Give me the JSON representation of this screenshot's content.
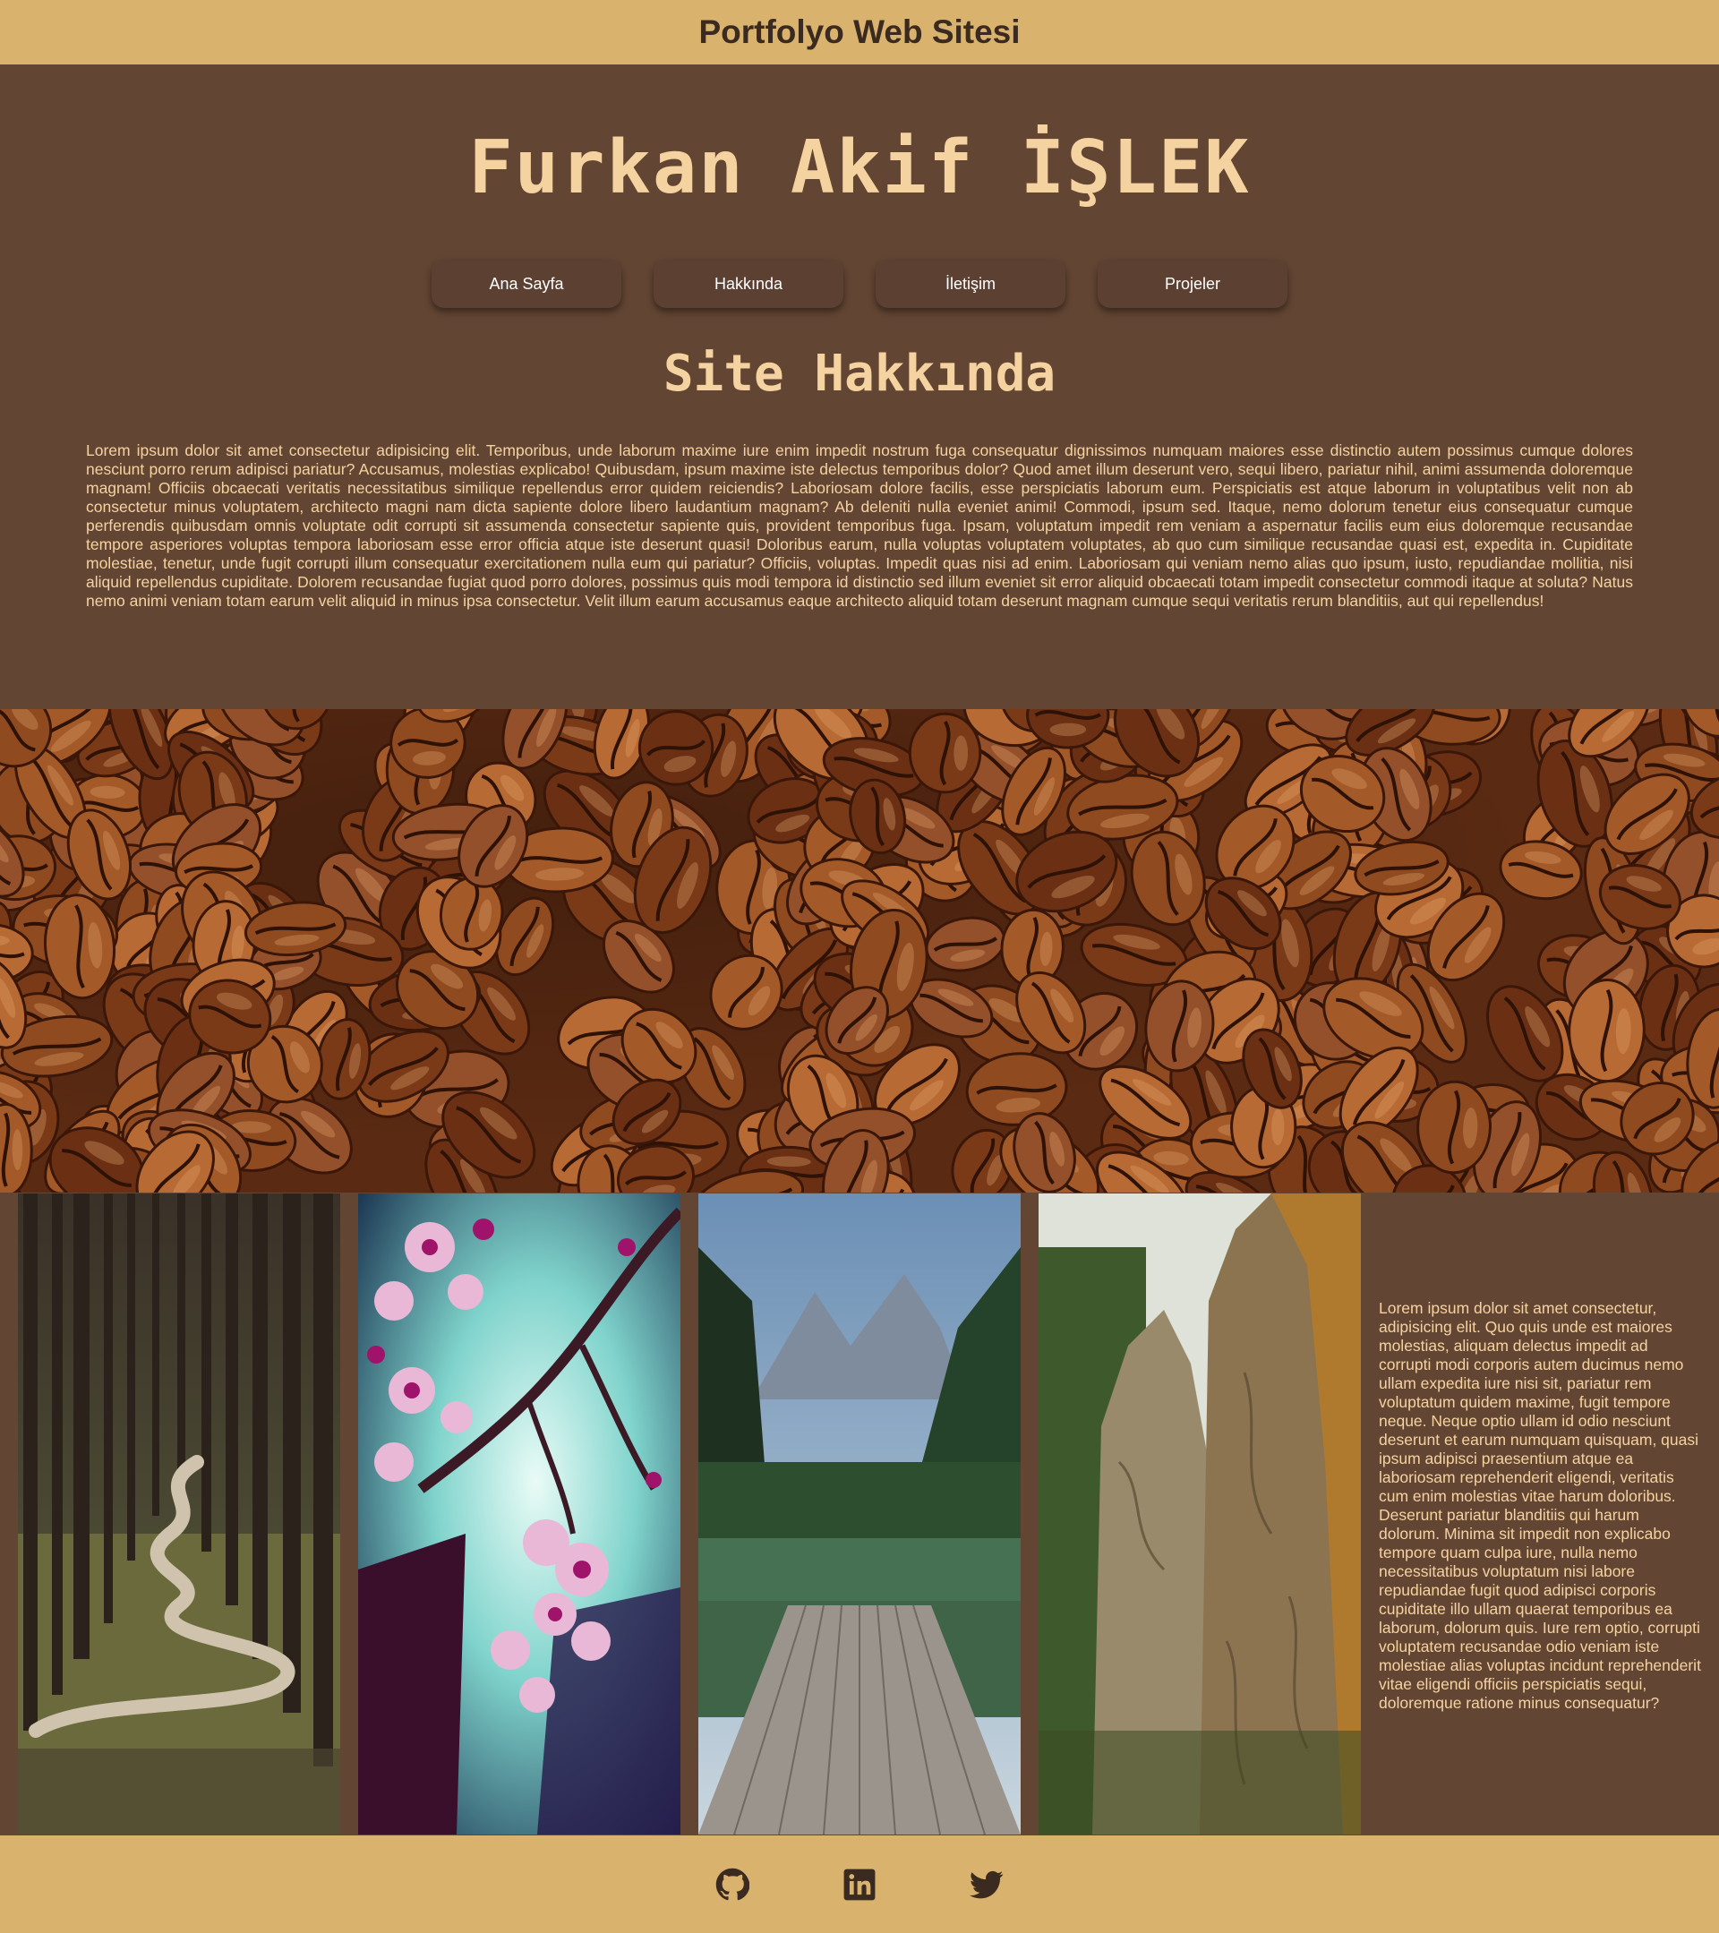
{
  "header": {
    "title": "Portfolyo Web Sitesi"
  },
  "hero": {
    "name": "Furkan Akif İŞLEK"
  },
  "nav": {
    "items": [
      {
        "label": "Ana Sayfa"
      },
      {
        "label": "Hakkında"
      },
      {
        "label": "İletişim"
      },
      {
        "label": "Projeler"
      }
    ]
  },
  "about": {
    "title": "Site Hakkında",
    "text": "Lorem ipsum dolor sit amet consectetur adipisicing elit. Temporibus, unde laborum maxime iure enim impedit nostrum fuga consequatur dignissimos numquam maiores esse distinctio autem possimus cumque dolores nesciunt porro rerum adipisci pariatur? Accusamus, molestias explicabo! Quibusdam, ipsum maxime iste delectus temporibus dolor? Quod amet illum deserunt vero, sequi libero, pariatur nihil, animi assumenda doloremque magnam! Officiis obcaecati veritatis necessitatibus similique repellendus error quidem reiciendis? Laboriosam dolore facilis, esse perspiciatis laborum eum. Perspiciatis est atque laborum in voluptatibus velit non ab consectetur minus voluptatem, architecto magni nam dicta sapiente dolore libero laudantium magnam? Ab deleniti nulla eveniet animi! Commodi, ipsum sed. Itaque, nemo dolorum tenetur eius consequatur cumque perferendis quibusdam omnis voluptate odit corrupti sit assumenda consectetur sapiente quis, provident temporibus fuga. Ipsam, voluptatum impedit rem veniam a aspernatur facilis eum eius doloremque recusandae tempore asperiores voluptas tempora laboriosam esse error officia atque iste deserunt quasi! Doloribus earum, nulla voluptas voluptatem voluptates, ab quo cum similique recusandae quasi est, expedita in. Cupiditate molestiae, tenetur, unde fugit corrupti illum consequatur exercitationem nulla eum qui pariatur? Officiis, voluptas. Impedit quas nisi ad enim. Laboriosam qui veniam nemo alias quo ipsum, iusto, repudiandae mollitia, nisi aliquid repellendus cupiditate. Dolorem recusandae fugiat quod porro dolores, possimus quis modi tempora id distinctio sed illum eveniet sit error aliquid obcaecati totam impedit consectetur commodi itaque at soluta? Natus nemo animi veniam totam earum velit aliquid in minus ipsa consectetur. Velit illum earum accusamus eaque architecto aliquid totam deserunt magnam cumque sequi veritatis rerum blanditiis, aut qui repellendus!"
  },
  "gallery": {
    "text": "Lorem ipsum dolor sit amet consectetur, adipisicing elit. Quo quis unde est maiores molestias, aliquam delectus impedit ad corrupti modi corporis autem ducimus nemo ullam expedita iure nisi sit, pariatur rem voluptatum quidem maxime, fugit tempore neque. Neque optio ullam id odio nesciunt deserunt et earum numquam quisquam, quasi ipsum adipisci praesentium atque ea laboriosam reprehenderit eligendi, veritatis cum enim molestias vitae harum doloribus. Deserunt pariatur blanditiis qui harum dolorum. Minima sit impedit non explicabo tempore quam culpa iure, nulla nemo necessitatibus voluptatum nisi labore repudiandae fugit quod adipisci corporis cupiditate illo ullam quaerat temporibus ea laborum, dolorum quis. Iure rem optio, corrupti voluptatem recusandae odio veniam iste molestiae alias voluptas incidunt reprehenderit vitae eligendi officiis perspiciatis sequi, doloremque ratione minus consequatur?"
  },
  "footer": {
    "icons": [
      "github-icon",
      "linkedin-icon",
      "twitter-icon"
    ]
  },
  "colors": {
    "background": "#634533",
    "bar": "#d9b26e",
    "accent_text": "#f5d3a0"
  }
}
